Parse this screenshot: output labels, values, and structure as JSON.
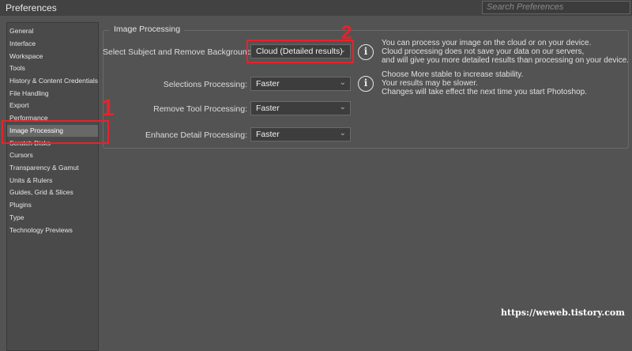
{
  "window": {
    "title": "Preferences"
  },
  "search": {
    "placeholder": "Search Preferences"
  },
  "sidebar": {
    "items": [
      {
        "label": "General"
      },
      {
        "label": "Interface"
      },
      {
        "label": "Workspace"
      },
      {
        "label": "Tools"
      },
      {
        "label": "History & Content Credentials"
      },
      {
        "label": "File Handling"
      },
      {
        "label": "Export"
      },
      {
        "label": "Performance"
      },
      {
        "label": "Image Processing",
        "selected": true
      },
      {
        "label": "Scratch Disks"
      },
      {
        "label": "Cursors"
      },
      {
        "label": "Transparency & Gamut"
      },
      {
        "label": "Units & Rulers"
      },
      {
        "label": "Guides, Grid & Slices"
      },
      {
        "label": "Plugins"
      },
      {
        "label": "Type"
      },
      {
        "label": "Technology Previews"
      }
    ]
  },
  "image_processing": {
    "group_title": "Image Processing",
    "select_subject": {
      "label": "Select Subject and Remove Background:",
      "value": "Cloud (Detailed results)"
    },
    "selections": {
      "label": "Selections Processing:",
      "value": "Faster"
    },
    "remove_tool": {
      "label": "Remove Tool Processing:",
      "value": "Faster"
    },
    "enhance_detail": {
      "label": "Enhance Detail Processing:",
      "value": "Faster"
    },
    "info_cloud": {
      "line1": "You can process your image on the cloud or on your device.",
      "line2": "Cloud processing does not save your data on our servers,",
      "line3": "and will give you more detailed results than processing on your device."
    },
    "info_stability": {
      "line1": "Choose More stable to increase stability.",
      "line2": "Your results may be slower.",
      "line3": "Changes will take effect the next time you start Photoshop."
    }
  },
  "annotations": {
    "marker1": "1",
    "marker2": "2",
    "watermark": "https://weweb.tistory.com",
    "color": "#e8222a"
  }
}
